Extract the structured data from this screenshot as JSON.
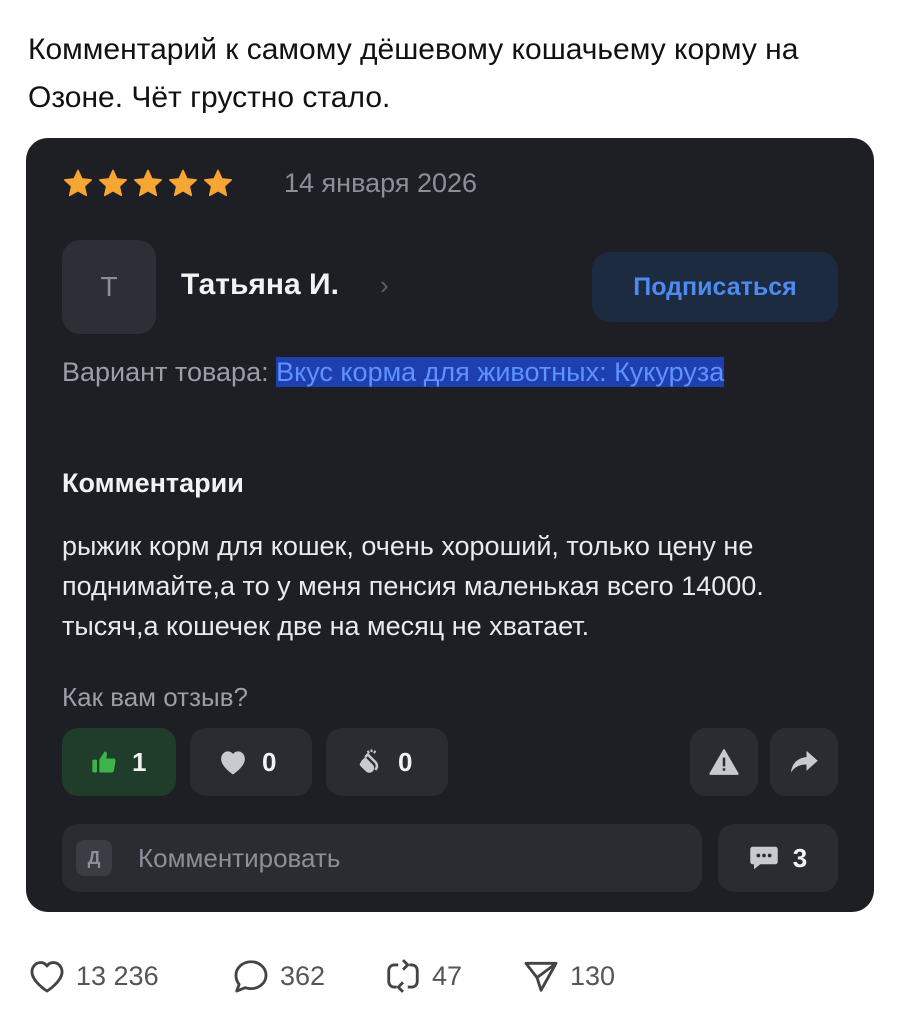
{
  "post": {
    "text": "Комментарий к самому дёшевому кошачьему корму на Озоне. Чёт грустно стало."
  },
  "review": {
    "rating": 5,
    "date": "14 января 2026",
    "author": {
      "initial": "Т",
      "name": "Татьяна И."
    },
    "subscribe_label": "Подписаться",
    "variant": {
      "label": "Вариант товара:",
      "value": "Вкус корма для животных: Кукуруза"
    },
    "comments_heading": "Комментарии",
    "text": "рыжик корм для кошек, очень хороший, только цену не поднимайте,а то у меня пенсия маленькая всего 14000. тысяч,а кошечек две на месяц не хватает.",
    "question": "Как вам отзыв?",
    "reactions": {
      "like": "1",
      "heart": "0",
      "clap": "0"
    },
    "comment_input": {
      "avatar_initial": "Д",
      "placeholder": "Комментировать"
    },
    "comments_count": "3"
  },
  "stats": {
    "likes": "13 236",
    "comments": "362",
    "reposts": "47",
    "views": "130"
  },
  "colors": {
    "card_bg": "#1d1f24",
    "star": "#f7a533",
    "accent_blue": "#4e8bf0",
    "like_green": "#3bb44a"
  }
}
